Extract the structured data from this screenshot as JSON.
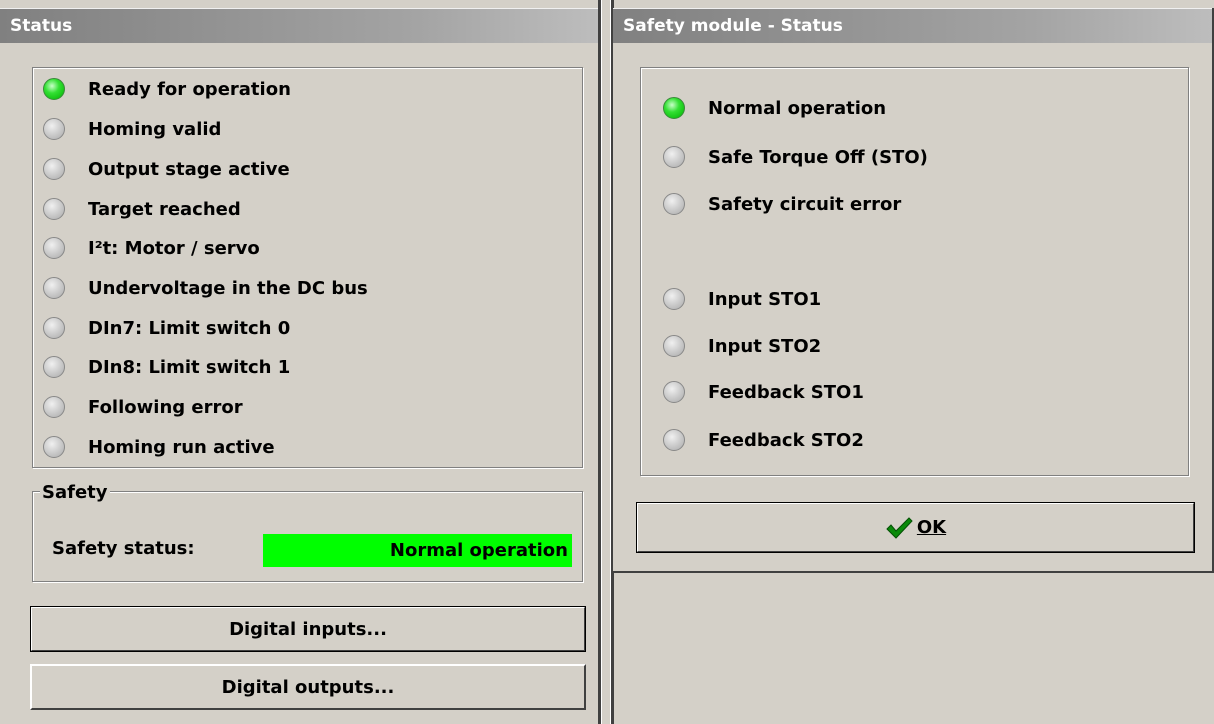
{
  "status_window": {
    "title": "Status",
    "indicators": [
      {
        "label": "Ready for operation",
        "on": true
      },
      {
        "label": "Homing valid",
        "on": false
      },
      {
        "label": "Output stage active",
        "on": false
      },
      {
        "label": "Target reached",
        "on": false
      },
      {
        "label": "I²t: Motor / servo",
        "on": false
      },
      {
        "label": "Undervoltage in the DC bus",
        "on": false
      },
      {
        "label": "DIn7: Limit switch 0",
        "on": false
      },
      {
        "label": "DIn8: Limit switch 1",
        "on": false
      },
      {
        "label": "Following error",
        "on": false
      },
      {
        "label": "Homing run active",
        "on": false
      }
    ],
    "safety_group": {
      "legend": "Safety",
      "status_label": "Safety status:",
      "status_value": "Normal operation",
      "status_color": "#00ff00"
    },
    "buttons": {
      "digital_inputs": "Digital inputs...",
      "digital_outputs": "Digital outputs..."
    }
  },
  "safety_window": {
    "title": "Safety module - Status",
    "indicators": [
      {
        "label": "Normal operation",
        "on": true
      },
      {
        "label": "Safe Torque Off (STO)",
        "on": false
      },
      {
        "label": "Safety circuit error",
        "on": false
      },
      {
        "label": "Input STO1",
        "on": false
      },
      {
        "label": "Input STO2",
        "on": false
      },
      {
        "label": "Feedback STO1",
        "on": false
      },
      {
        "label": "Feedback STO2",
        "on": false
      }
    ],
    "ok_button": {
      "label": "OK",
      "icon": "checkmark-icon"
    }
  },
  "colors": {
    "led_on": "#00c800",
    "led_off": "#c0c0c0",
    "titlebar": "#a0a0a0"
  }
}
